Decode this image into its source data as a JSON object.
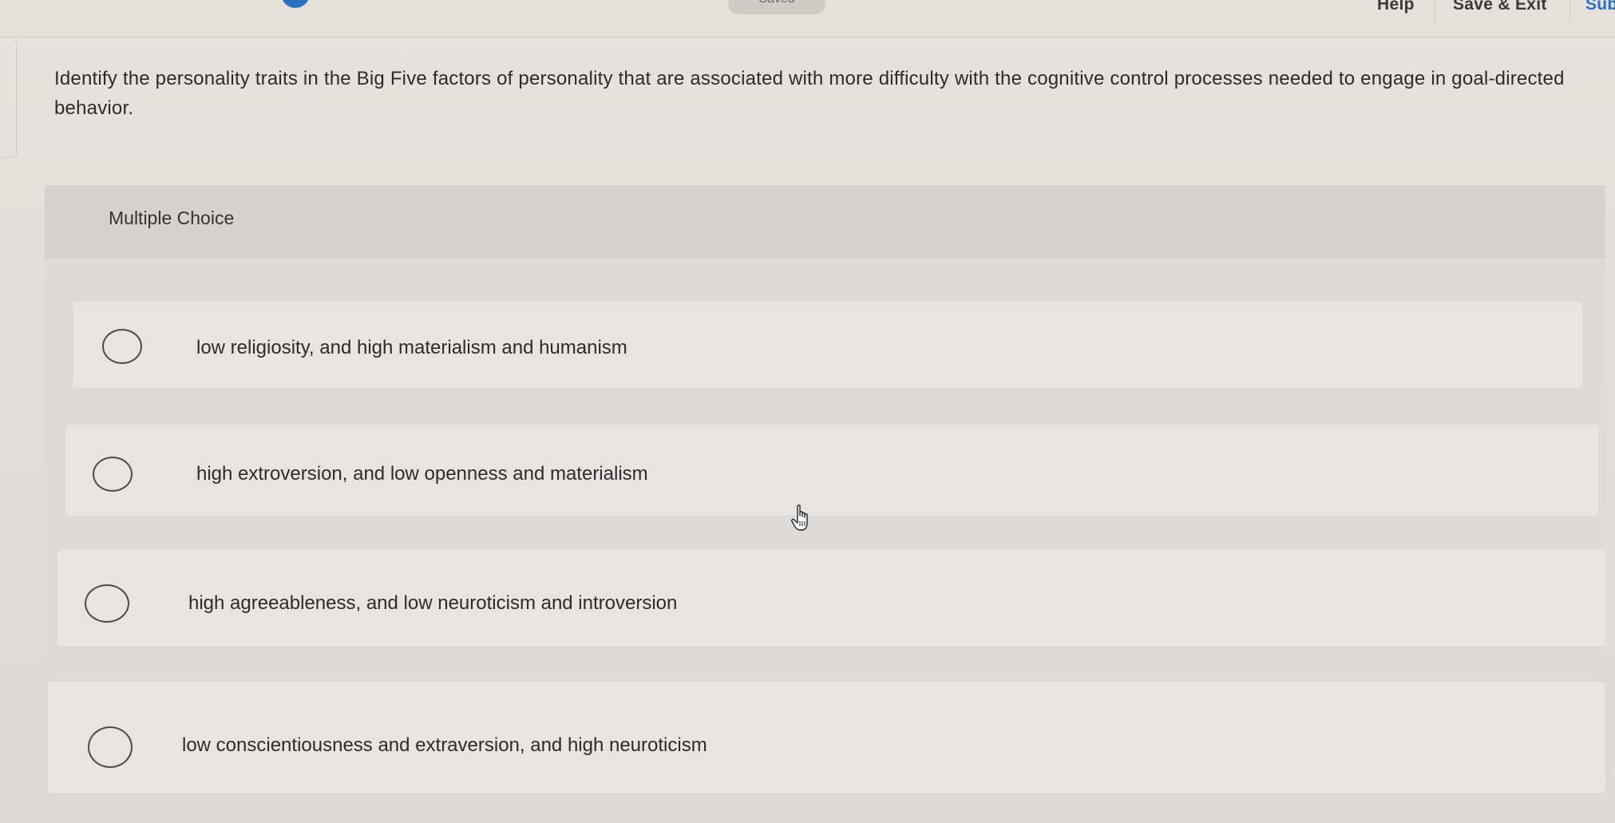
{
  "topbar": {
    "saved_label": "Saved",
    "help_label": "Help",
    "save_exit_label": "Save & Exit",
    "submit_label": "Submit"
  },
  "question": {
    "text": "Identify the personality traits in the Big Five factors of personality that are associated with more difficulty with the cognitive control processes needed to engage in goal-directed behavior."
  },
  "multiple_choice": {
    "label": "Multiple Choice",
    "options": [
      {
        "text": "low religiosity, and high materialism and humanism"
      },
      {
        "text": "high extroversion, and low openness and materialism"
      },
      {
        "text": "high agreeableness, and low neuroticism and introversion"
      },
      {
        "text": "low conscientiousness and extraversion, and high neuroticism"
      }
    ]
  },
  "colors": {
    "accent": "#2a6fc0",
    "background": "#e2dedb",
    "option_background": "#e7e4e2"
  },
  "icons": {
    "cursor": "hand-pointer-icon",
    "radio": "radio-circle-icon"
  }
}
